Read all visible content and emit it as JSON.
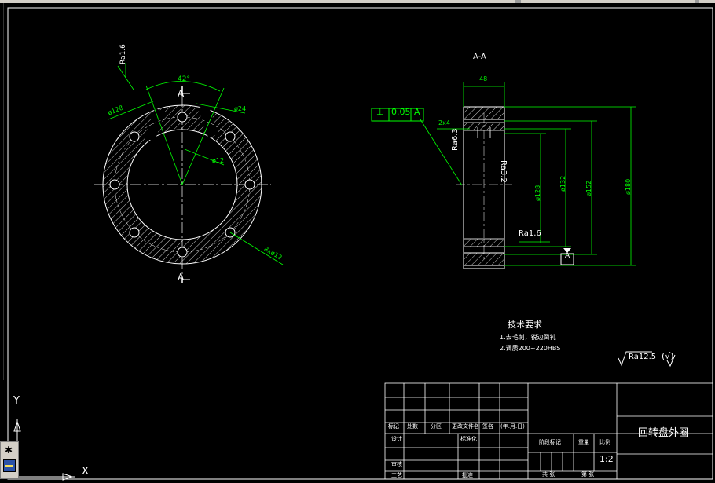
{
  "views": {
    "section_label": "A-A",
    "section_marker": "A"
  },
  "left_view": {
    "roughness": "Ra1.6",
    "angle": "42°",
    "dim_a": "ø128",
    "dim_b": "ø24",
    "dim_c": "ø12",
    "holes": "8xø12"
  },
  "right_view": {
    "width": "48",
    "tolerance_symbol": "⊥",
    "tolerance_value": "0.05",
    "tolerance_datum": "A",
    "chamfer": "2x4",
    "ra_a": "Ra6.3",
    "ra_b": "Ra3.2",
    "ra_c": "Ra1.6",
    "dia_1": "ø128",
    "dia_2": "ø132",
    "dia_3": "ø152",
    "dia_4": "ø180",
    "datum_box": "A"
  },
  "tech_req": {
    "title": "技术要求",
    "line1": "1.去毛刺，锐边倒钝",
    "line2": "2.调质200~220HBS"
  },
  "surface_finish": {
    "global": "Ra12.5",
    "other": "(√)"
  },
  "title_block": {
    "part_name": "回转盘外圈",
    "scale": "1:2",
    "headers": [
      "标记",
      "处数",
      "分区",
      "更改文件名",
      "签名",
      "(年.月.日)"
    ],
    "rows": [
      "设计",
      "标准化",
      "审核",
      "工艺",
      "批准"
    ],
    "stage_label": "阶段标记",
    "weight_label": "重量",
    "scale_label": "比例",
    "sheets_label": "共 张",
    "sheet_label": "第 张"
  },
  "ucs": {
    "y_label": "Y",
    "x_label": "X"
  }
}
